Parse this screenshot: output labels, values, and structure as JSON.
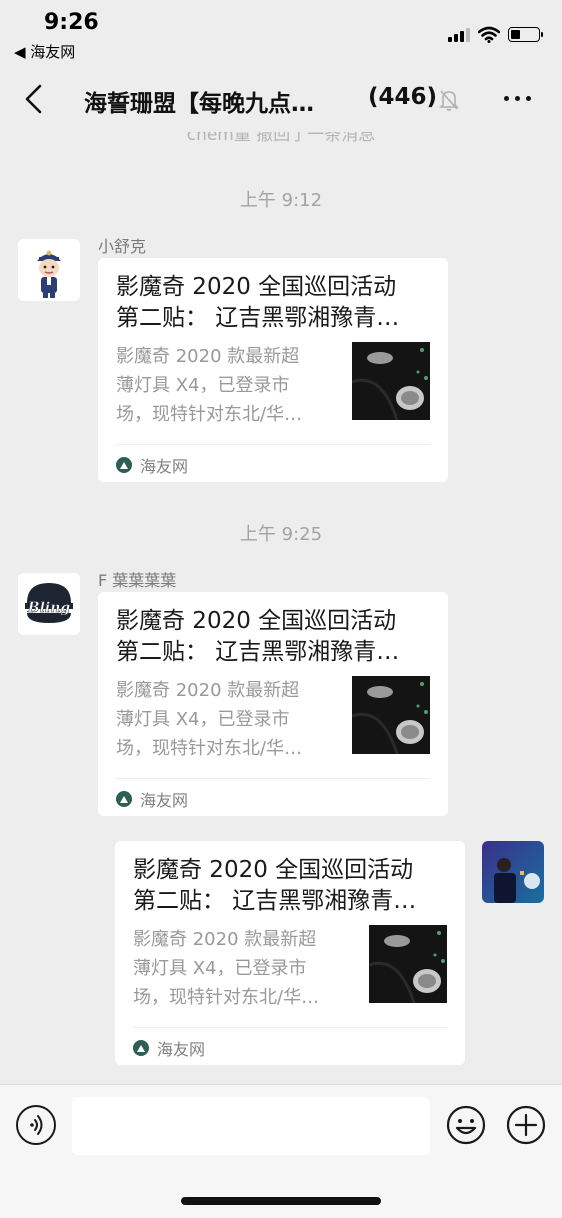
{
  "status": {
    "time": "9:26",
    "back_app": "◀ 海友网"
  },
  "nav": {
    "title": "海誓珊盟【每晚九点…",
    "count": "(446)"
  },
  "chat": {
    "partial_text": "chem量 撤回了一条消息",
    "messages": [
      {
        "time": "上午 9:12",
        "sender": "小舒克",
        "title": "影魔奇 2020 全国巡回活动第二贴： 辽吉黑鄂湘豫青…",
        "title_line1": "影魔奇 2020 全国巡回活动",
        "title_line2": "第二贴： 辽吉黑鄂湘豫青…",
        "desc_line1": "影魔奇 2020 款最新超",
        "desc_line2": "薄灯具 X4，已登录市",
        "desc_line3": "场，现特针对东北/华…",
        "source": "海友网"
      },
      {
        "time": "上午 9:25",
        "sender": "F 葉葉葉葉",
        "avatar_text": "Bling",
        "title_line1": "影魔奇 2020 全国巡回活动",
        "title_line2": "第二贴： 辽吉黑鄂湘豫青…",
        "desc_line1": "影魔奇 2020 款最新超",
        "desc_line2": "薄灯具 X4，已登录市",
        "desc_line3": "场，现特针对东北/华…",
        "source": "海友网"
      },
      {
        "title_line1": "影魔奇 2020 全国巡回活动",
        "title_line2": "第二贴： 辽吉黑鄂湘豫青…",
        "desc_line1": "影魔奇 2020 款最新超",
        "desc_line2": "薄灯具 X4，已登录市",
        "desc_line3": "场，现特针对东北/华…",
        "source": "海友网"
      }
    ]
  },
  "input": {
    "value": "",
    "placeholder": ""
  },
  "colors": {
    "background": "#ededed",
    "card": "#ffffff",
    "source_icon": "#2f5e55"
  }
}
